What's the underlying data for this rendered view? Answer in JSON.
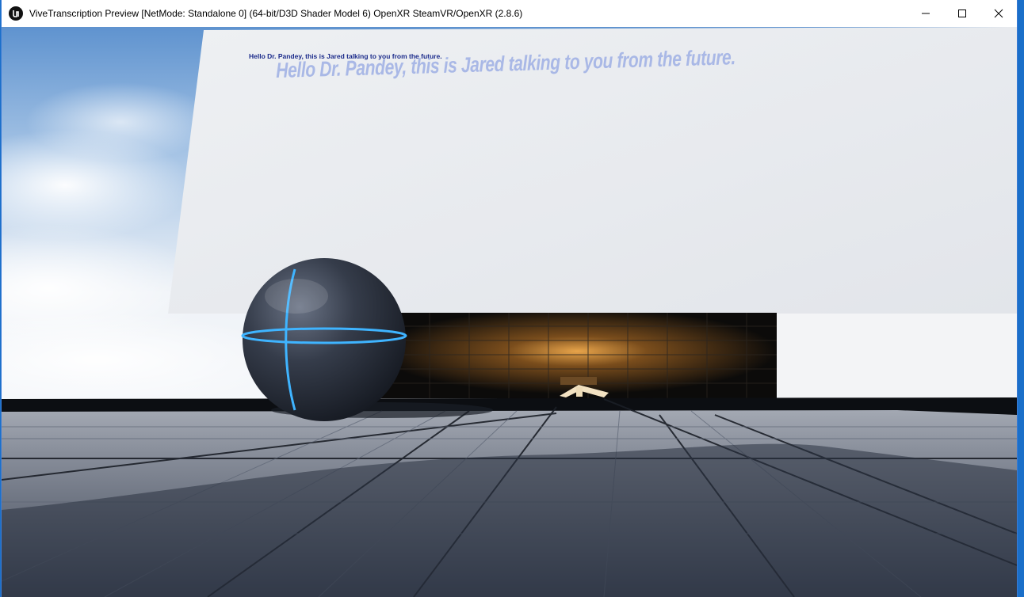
{
  "window": {
    "title": "ViveTranscription Preview [NetMode: Standalone 0]  (64-bit/D3D Shader Model 6) OpenXR SteamVR/OpenXR (2.8.6)",
    "app_icon": "unreal-engine-icon",
    "controls": [
      "minimize-icon",
      "maximize-icon",
      "close-icon"
    ]
  },
  "scene": {
    "caption_small": "Hello Dr. Pandey, this is Jared talking to you from the future.",
    "caption_large": "Hello Dr. Pandey, this is Jared talking to you from the future."
  },
  "colors": {
    "caption_small": "#1a2a8a",
    "caption_large": "#a9b8e6",
    "sphere_accent": "#3fb4ff"
  }
}
